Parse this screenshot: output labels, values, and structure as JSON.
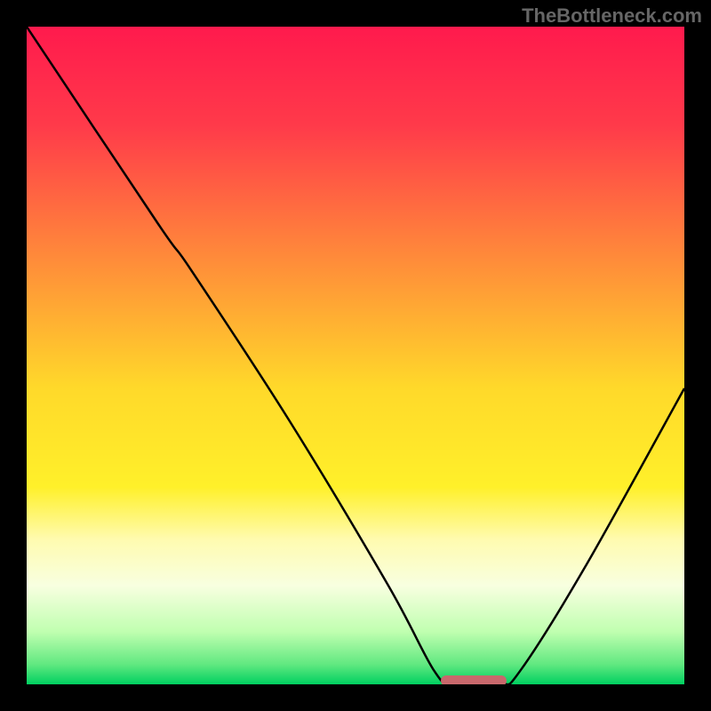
{
  "watermark": "TheBottleneck.com",
  "chart_data": {
    "type": "line",
    "title": "",
    "xlabel": "",
    "ylabel": "",
    "xlim": [
      0,
      100
    ],
    "ylim": [
      0,
      100
    ],
    "curve_points": [
      {
        "x": 0,
        "y": 100
      },
      {
        "x": 20,
        "y": 70
      },
      {
        "x": 25,
        "y": 63
      },
      {
        "x": 40,
        "y": 40
      },
      {
        "x": 55,
        "y": 15
      },
      {
        "x": 62,
        "y": 2
      },
      {
        "x": 65,
        "y": 0
      },
      {
        "x": 72,
        "y": 0
      },
      {
        "x": 75,
        "y": 2
      },
      {
        "x": 85,
        "y": 18
      },
      {
        "x": 100,
        "y": 45
      }
    ],
    "marker": {
      "x_start": 63,
      "x_end": 73,
      "y": 0.5,
      "color": "#c9686c"
    },
    "gradient_stops": [
      {
        "offset": 0,
        "color": "#ff1a4d"
      },
      {
        "offset": 15,
        "color": "#ff3a4a"
      },
      {
        "offset": 35,
        "color": "#ff8a3a"
      },
      {
        "offset": 55,
        "color": "#ffd92a"
      },
      {
        "offset": 70,
        "color": "#fff02a"
      },
      {
        "offset": 78,
        "color": "#fffbb0"
      },
      {
        "offset": 85,
        "color": "#f8ffe0"
      },
      {
        "offset": 92,
        "color": "#c0ffb0"
      },
      {
        "offset": 97,
        "color": "#60e880"
      },
      {
        "offset": 100,
        "color": "#00d060"
      }
    ]
  }
}
